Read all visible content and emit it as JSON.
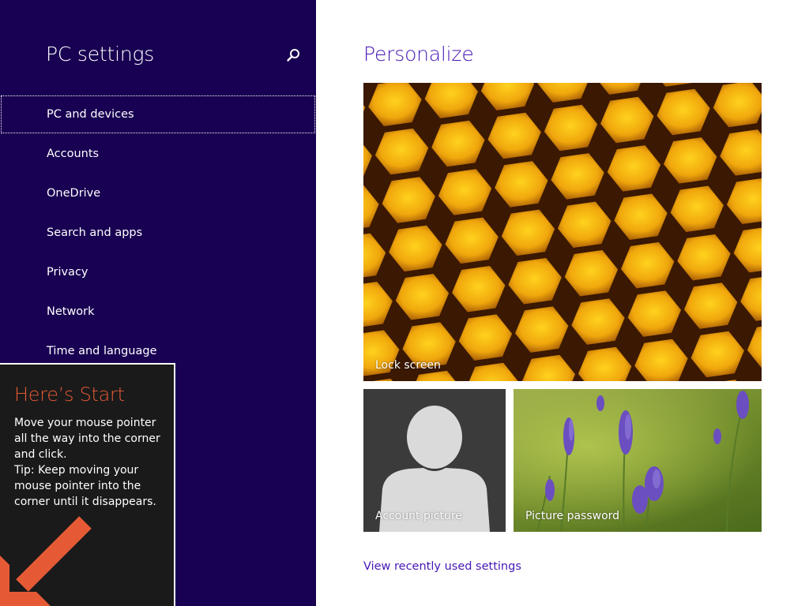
{
  "left_pane": {
    "title": "PC settings",
    "search_icon": "search-icon",
    "nav_items": [
      {
        "label": "PC and devices",
        "selected": true
      },
      {
        "label": "Accounts",
        "selected": false
      },
      {
        "label": "OneDrive",
        "selected": false
      },
      {
        "label": "Search and apps",
        "selected": false
      },
      {
        "label": "Privacy",
        "selected": false
      },
      {
        "label": "Network",
        "selected": false
      },
      {
        "label": "Time and language",
        "selected": false
      }
    ]
  },
  "start_tip": {
    "heading": "Here’s Start",
    "body_lines": [
      "Move your mouse pointer",
      "all the way into the corner",
      "and click.",
      "Tip: Keep moving your",
      "mouse pointer into the",
      "corner until it disappears."
    ],
    "arrow_icon": "arrow-down-left-icon"
  },
  "main": {
    "title": "Personalize",
    "tiles": {
      "lock_screen": {
        "label": "Lock screen"
      },
      "account_picture": {
        "label": "Account picture"
      },
      "picture_password": {
        "label": "Picture password"
      }
    },
    "recent_link": "View recently used settings"
  },
  "colors": {
    "left_pane_bg": "#180052",
    "accent": "#4617b4",
    "tip_heading": "#e55a35",
    "tip_arrow": "#e55a35",
    "account_tile_bg": "#3b3b3b"
  }
}
